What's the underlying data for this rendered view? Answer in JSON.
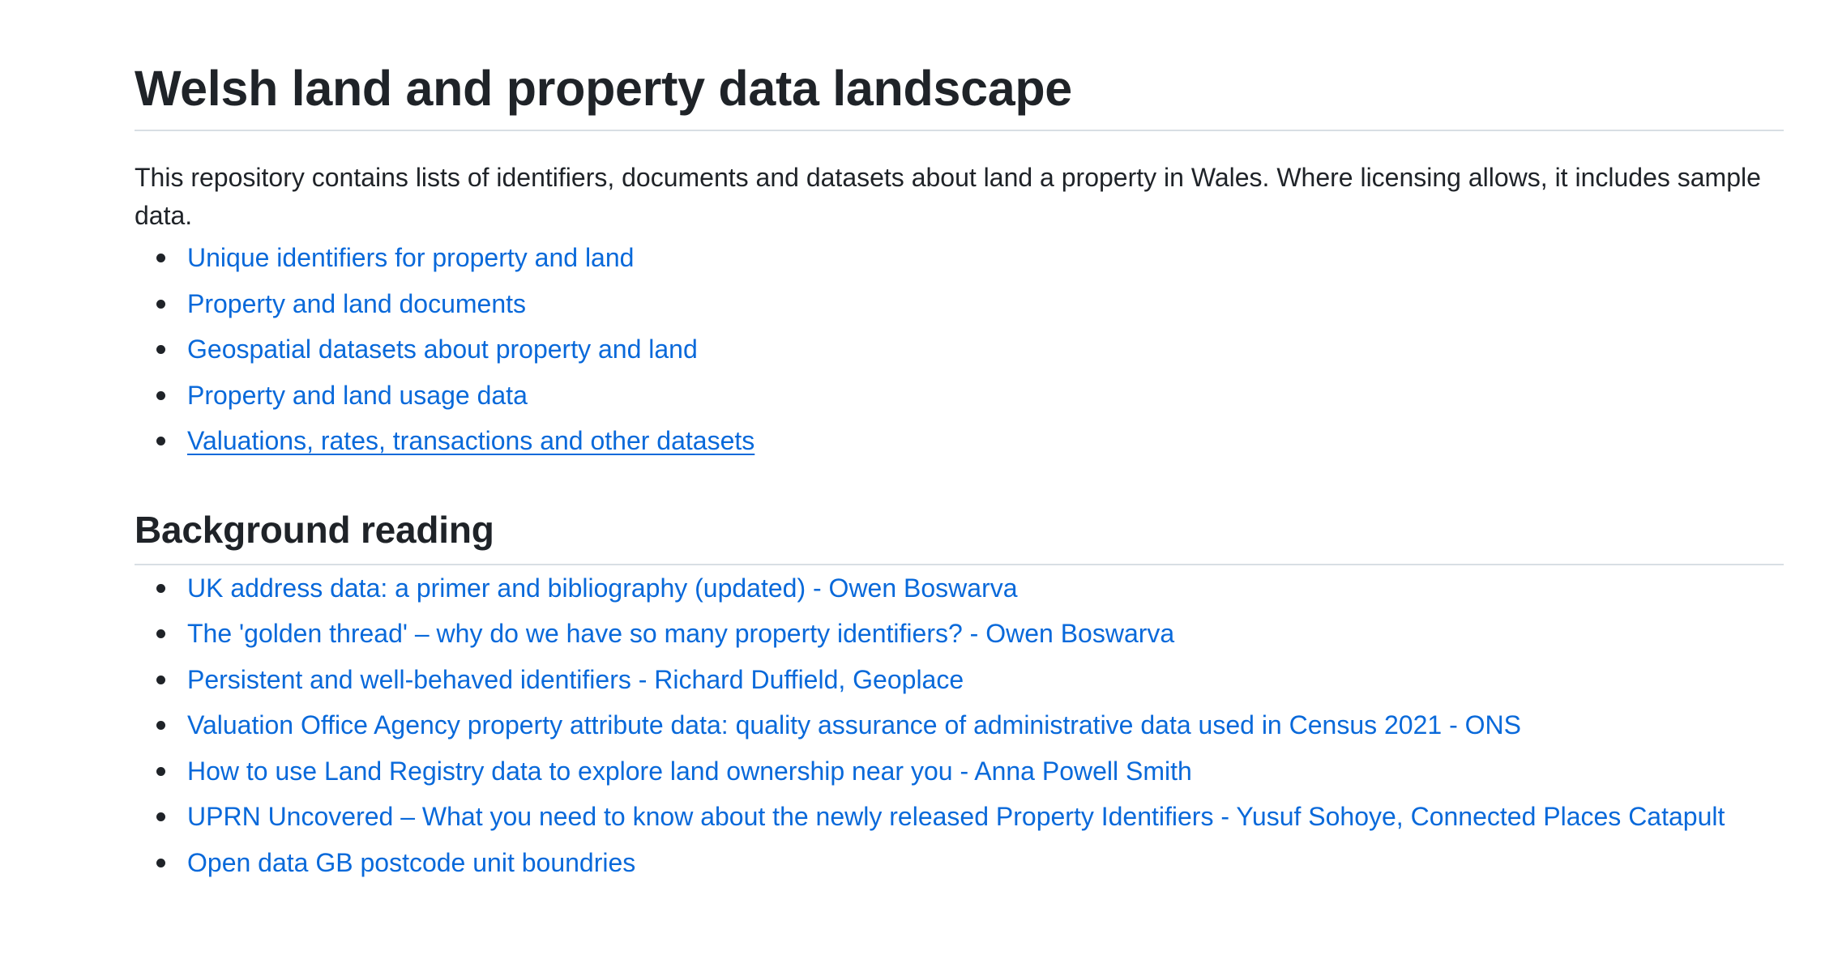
{
  "readme": {
    "title": "Welsh land and property data landscape",
    "intro": "This repository contains lists of identifiers, documents and datasets about land a property in Wales. Where licensing allows, it includes sample data.",
    "contents_links": [
      {
        "label": "Unique identifiers for property and land"
      },
      {
        "label": "Property and land documents"
      },
      {
        "label": "Geospatial datasets about property and land"
      },
      {
        "label": "Property and land usage data"
      },
      {
        "label": "Valuations, rates, transactions and other datasets",
        "hovered": true
      }
    ],
    "background_heading": "Background reading",
    "background_links": [
      {
        "label": "UK address data: a primer and bibliography (updated) - Owen Boswarva"
      },
      {
        "label": "The 'golden thread' – why do we have so many property identifiers? - Owen Boswarva"
      },
      {
        "label": "Persistent and well-behaved identifiers - Richard Duffield, Geoplace"
      },
      {
        "label": "Valuation Office Agency property attribute data: quality assurance of administrative data used in Census 2021 - ONS"
      },
      {
        "label": "How to use Land Registry data to explore land ownership near you - Anna Powell Smith"
      },
      {
        "label": "UPRN Uncovered – What you need to know about the newly released Property Identifiers - Yusuf Sohoye, Connected Places Catapult"
      },
      {
        "label": "Open data GB postcode unit boundries"
      }
    ]
  },
  "colors": {
    "link": "#0969da",
    "text": "#1f2328",
    "rule": "#d8dee4"
  }
}
